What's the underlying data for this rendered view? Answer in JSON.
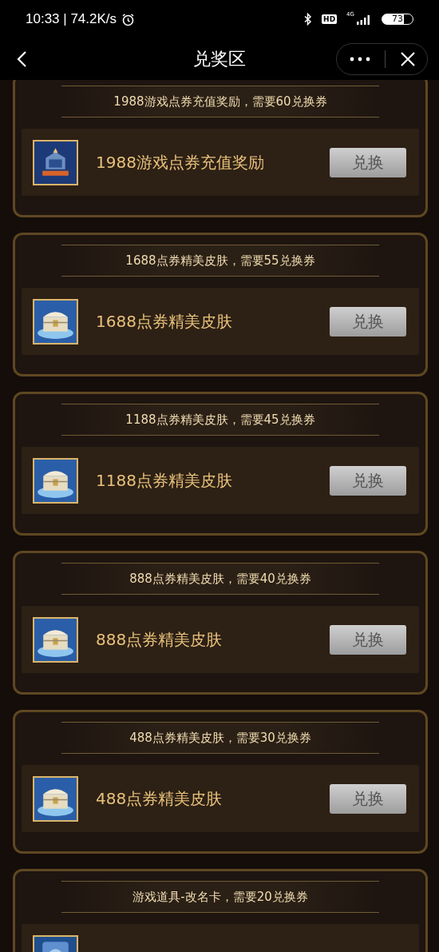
{
  "status_bar": {
    "time": "10:33 | 74.2K/s",
    "hd": "HD",
    "network": "4G",
    "battery": "73"
  },
  "nav": {
    "title": "兑奖区"
  },
  "rewards": [
    {
      "heading": "1988游戏点券充值奖励，需要60兑换券",
      "name": "1988游戏点券充值奖励",
      "button": "兑换",
      "kind": "poster"
    },
    {
      "heading": "1688点券精美皮肤，需要55兑换券",
      "name": "1688点券精美皮肤",
      "button": "兑换",
      "kind": "chest"
    },
    {
      "heading": "1188点券精美皮肤，需要45兑换券",
      "name": "1188点券精美皮肤",
      "button": "兑换",
      "kind": "chest"
    },
    {
      "heading": "888点券精美皮肤，需要40兑换券",
      "name": "888点券精美皮肤",
      "button": "兑换",
      "kind": "chest"
    },
    {
      "heading": "488点券精美皮肤，需要30兑换券",
      "name": "488点券精美皮肤",
      "button": "兑换",
      "kind": "chest"
    },
    {
      "heading": "游戏道具-改名卡，需要20兑换券",
      "kind": "card"
    }
  ]
}
